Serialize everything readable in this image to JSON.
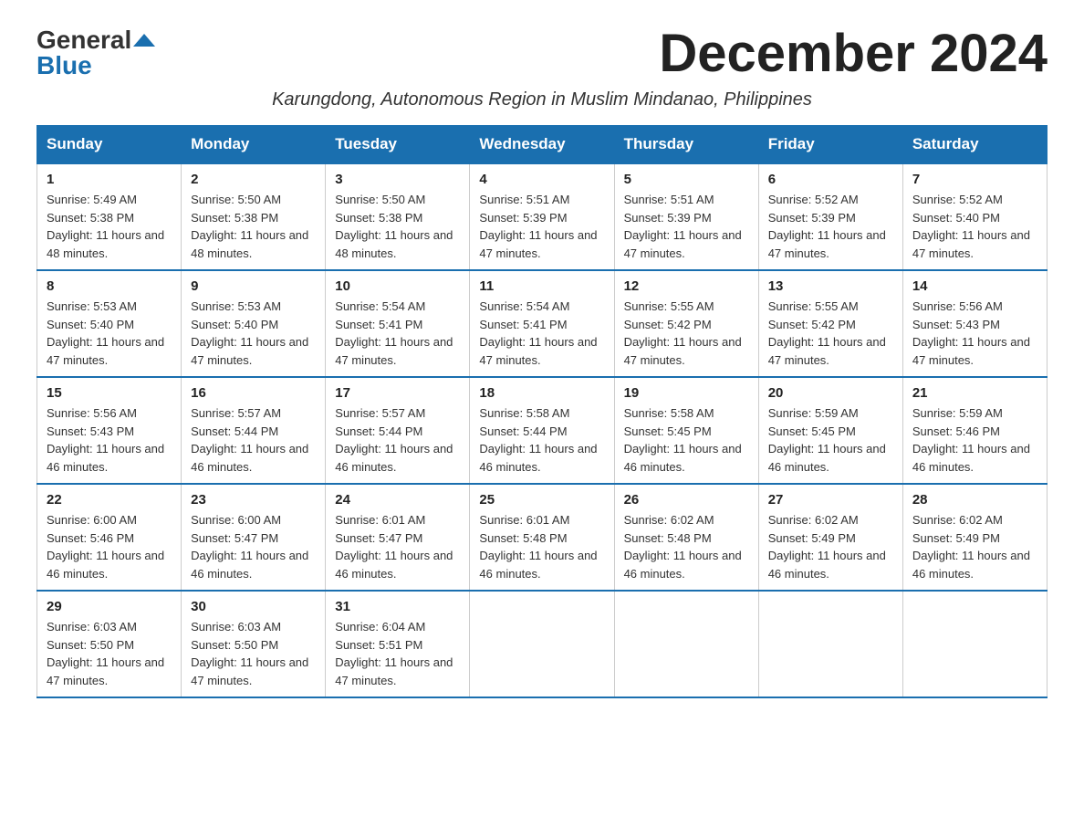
{
  "logo": {
    "general": "General",
    "blue": "Blue"
  },
  "title": "December 2024",
  "subtitle": "Karungdong, Autonomous Region in Muslim Mindanao, Philippines",
  "weekdays": [
    "Sunday",
    "Monday",
    "Tuesday",
    "Wednesday",
    "Thursday",
    "Friday",
    "Saturday"
  ],
  "weeks": [
    [
      {
        "day": "1",
        "sunrise": "5:49 AM",
        "sunset": "5:38 PM",
        "daylight": "11 hours and 48 minutes."
      },
      {
        "day": "2",
        "sunrise": "5:50 AM",
        "sunset": "5:38 PM",
        "daylight": "11 hours and 48 minutes."
      },
      {
        "day": "3",
        "sunrise": "5:50 AM",
        "sunset": "5:38 PM",
        "daylight": "11 hours and 48 minutes."
      },
      {
        "day": "4",
        "sunrise": "5:51 AM",
        "sunset": "5:39 PM",
        "daylight": "11 hours and 47 minutes."
      },
      {
        "day": "5",
        "sunrise": "5:51 AM",
        "sunset": "5:39 PM",
        "daylight": "11 hours and 47 minutes."
      },
      {
        "day": "6",
        "sunrise": "5:52 AM",
        "sunset": "5:39 PM",
        "daylight": "11 hours and 47 minutes."
      },
      {
        "day": "7",
        "sunrise": "5:52 AM",
        "sunset": "5:40 PM",
        "daylight": "11 hours and 47 minutes."
      }
    ],
    [
      {
        "day": "8",
        "sunrise": "5:53 AM",
        "sunset": "5:40 PM",
        "daylight": "11 hours and 47 minutes."
      },
      {
        "day": "9",
        "sunrise": "5:53 AM",
        "sunset": "5:40 PM",
        "daylight": "11 hours and 47 minutes."
      },
      {
        "day": "10",
        "sunrise": "5:54 AM",
        "sunset": "5:41 PM",
        "daylight": "11 hours and 47 minutes."
      },
      {
        "day": "11",
        "sunrise": "5:54 AM",
        "sunset": "5:41 PM",
        "daylight": "11 hours and 47 minutes."
      },
      {
        "day": "12",
        "sunrise": "5:55 AM",
        "sunset": "5:42 PM",
        "daylight": "11 hours and 47 minutes."
      },
      {
        "day": "13",
        "sunrise": "5:55 AM",
        "sunset": "5:42 PM",
        "daylight": "11 hours and 47 minutes."
      },
      {
        "day": "14",
        "sunrise": "5:56 AM",
        "sunset": "5:43 PM",
        "daylight": "11 hours and 47 minutes."
      }
    ],
    [
      {
        "day": "15",
        "sunrise": "5:56 AM",
        "sunset": "5:43 PM",
        "daylight": "11 hours and 46 minutes."
      },
      {
        "day": "16",
        "sunrise": "5:57 AM",
        "sunset": "5:44 PM",
        "daylight": "11 hours and 46 minutes."
      },
      {
        "day": "17",
        "sunrise": "5:57 AM",
        "sunset": "5:44 PM",
        "daylight": "11 hours and 46 minutes."
      },
      {
        "day": "18",
        "sunrise": "5:58 AM",
        "sunset": "5:44 PM",
        "daylight": "11 hours and 46 minutes."
      },
      {
        "day": "19",
        "sunrise": "5:58 AM",
        "sunset": "5:45 PM",
        "daylight": "11 hours and 46 minutes."
      },
      {
        "day": "20",
        "sunrise": "5:59 AM",
        "sunset": "5:45 PM",
        "daylight": "11 hours and 46 minutes."
      },
      {
        "day": "21",
        "sunrise": "5:59 AM",
        "sunset": "5:46 PM",
        "daylight": "11 hours and 46 minutes."
      }
    ],
    [
      {
        "day": "22",
        "sunrise": "6:00 AM",
        "sunset": "5:46 PM",
        "daylight": "11 hours and 46 minutes."
      },
      {
        "day": "23",
        "sunrise": "6:00 AM",
        "sunset": "5:47 PM",
        "daylight": "11 hours and 46 minutes."
      },
      {
        "day": "24",
        "sunrise": "6:01 AM",
        "sunset": "5:47 PM",
        "daylight": "11 hours and 46 minutes."
      },
      {
        "day": "25",
        "sunrise": "6:01 AM",
        "sunset": "5:48 PM",
        "daylight": "11 hours and 46 minutes."
      },
      {
        "day": "26",
        "sunrise": "6:02 AM",
        "sunset": "5:48 PM",
        "daylight": "11 hours and 46 minutes."
      },
      {
        "day": "27",
        "sunrise": "6:02 AM",
        "sunset": "5:49 PM",
        "daylight": "11 hours and 46 minutes."
      },
      {
        "day": "28",
        "sunrise": "6:02 AM",
        "sunset": "5:49 PM",
        "daylight": "11 hours and 46 minutes."
      }
    ],
    [
      {
        "day": "29",
        "sunrise": "6:03 AM",
        "sunset": "5:50 PM",
        "daylight": "11 hours and 47 minutes."
      },
      {
        "day": "30",
        "sunrise": "6:03 AM",
        "sunset": "5:50 PM",
        "daylight": "11 hours and 47 minutes."
      },
      {
        "day": "31",
        "sunrise": "6:04 AM",
        "sunset": "5:51 PM",
        "daylight": "11 hours and 47 minutes."
      },
      null,
      null,
      null,
      null
    ]
  ]
}
